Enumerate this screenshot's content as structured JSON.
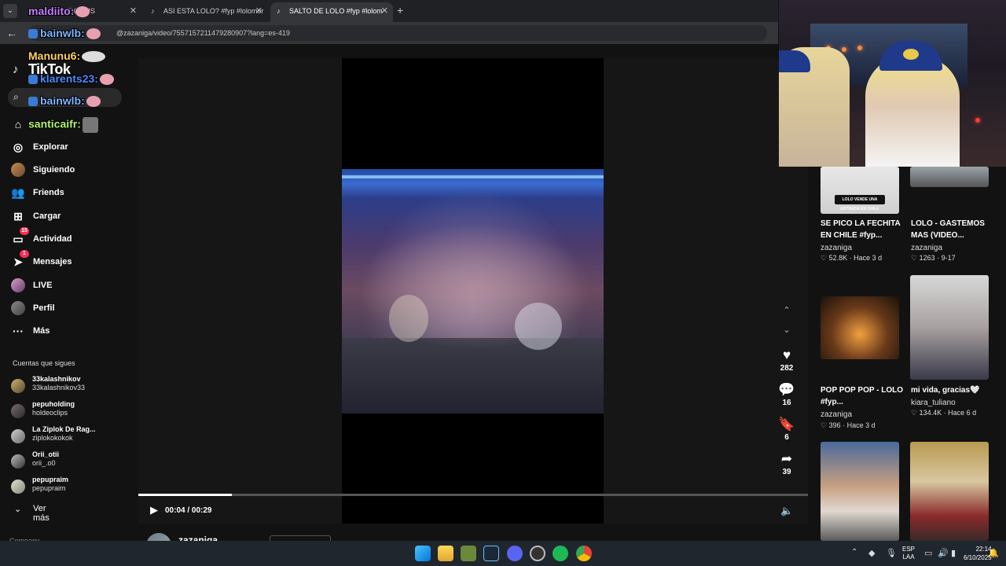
{
  "browser": {
    "tabs": [
      {
        "label": "... HIST EXCLUS",
        "active": false
      },
      {
        "label": "ASI ESTA LOLO? #fyp #lolomor",
        "active": false
      },
      {
        "label": "SALTO DE LOLO #fyp #lolom",
        "active": true
      }
    ],
    "new_tab": "+",
    "url": "@zazaniga/video/7557157211479280907?lang=es-419"
  },
  "sidebar": {
    "logo": "TikTok",
    "nav": [
      {
        "label": "Explorar",
        "icon": "compass-icon"
      },
      {
        "label": "Siguiendo",
        "icon": "following-avatar-icon"
      },
      {
        "label": "Friends",
        "icon": "friends-icon"
      },
      {
        "label": "Cargar",
        "icon": "upload-icon"
      },
      {
        "label": "Actividad",
        "icon": "activity-icon",
        "badge": "15"
      },
      {
        "label": "Mensajes",
        "icon": "messages-icon",
        "badge": "1"
      },
      {
        "label": "LIVE",
        "icon": "live-icon"
      },
      {
        "label": "Perfil",
        "icon": "profile-icon"
      },
      {
        "label": "Más",
        "icon": "more-icon"
      }
    ],
    "following_title": "Cuentas que sigues",
    "accounts": [
      {
        "name": "33kalashnikov",
        "handle": "33kalashnikov33"
      },
      {
        "name": "pepuholding",
        "handle": "holdeoclips"
      },
      {
        "name": "La Ziplok De Rag...",
        "handle": "ziplokokokok"
      },
      {
        "name": "Orii_otii",
        "handle": "orii_.o0"
      },
      {
        "name": "pepupraim",
        "handle": "pepupraim"
      }
    ],
    "ver_mas": "Ver más",
    "company": "Company"
  },
  "video": {
    "time": "00:04 / 00:29",
    "progress": 0.14,
    "author": "zazaniga"
  },
  "actions": {
    "likes": "282",
    "comments": "16",
    "saves": "6",
    "shares": "39"
  },
  "related": [
    {
      "title": "SE PICO LA FECHITA EN CHILE #fyp...",
      "author": "zazaniga",
      "views": "52.8K",
      "date": "Hace 3 d",
      "thumb_text": "LOLO VENDE UNA ENTRADA EN CHILE"
    },
    {
      "title": "LOLO - GASTEMOS MAS (VIDEO...",
      "author": "zazaniga",
      "views": "1263",
      "date": "9-17",
      "thumb_text": ""
    },
    {
      "title": "POP POP POP - LOLO #fyp...",
      "author": "zazaniga",
      "views": "396",
      "date": "Hace 3 d",
      "thumb_text": ""
    },
    {
      "title": "mi vida, gracias🤍",
      "author": "kiara_tuliano",
      "views": "134.4K",
      "date": "Hace 6 d",
      "thumb_text": ""
    }
  ],
  "chat": [
    {
      "user": "maldiito:",
      "color": "#c77dff"
    },
    {
      "user": "bainwlb:",
      "color": "#7fb3ff"
    },
    {
      "user": "Manunu6:",
      "color": "#ffd166"
    },
    {
      "user": "klarents23:",
      "color": "#4d8bff"
    },
    {
      "user": "bainwlb:",
      "color": "#7fb3ff"
    },
    {
      "user": "santicaifr:",
      "color": "#b6f36b"
    }
  ],
  "taskbar": {
    "lang_top": "ESP",
    "lang_bottom": "LAA",
    "time": "22:14",
    "date": "6/10/2025",
    "apps": [
      "start-icon",
      "file-explorer-icon",
      "app-icon",
      "steam-icon",
      "discord-icon",
      "obs-icon",
      "spotify-icon",
      "chrome-icon"
    ]
  }
}
